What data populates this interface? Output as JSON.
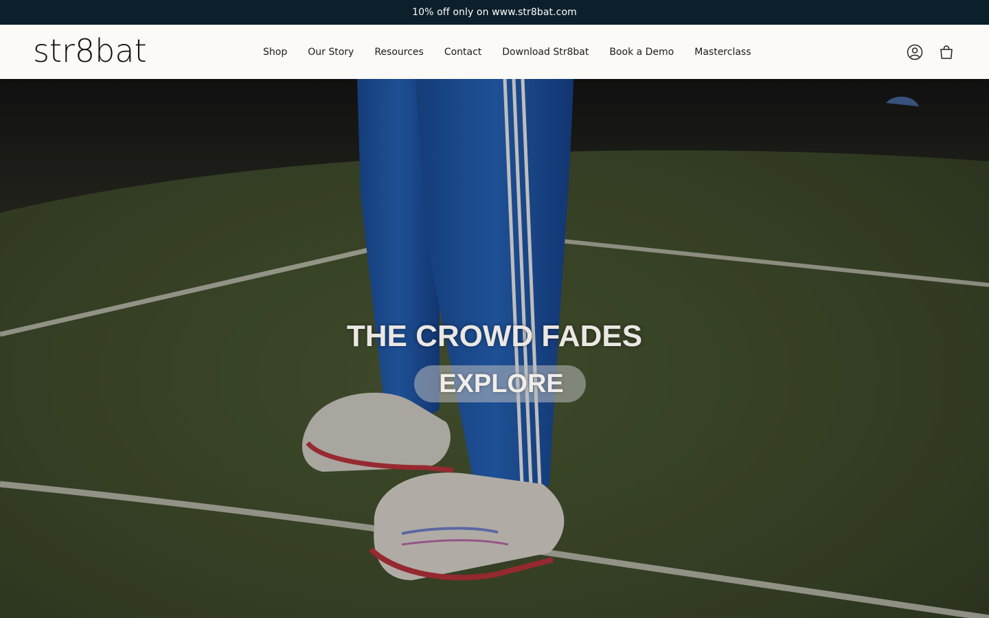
{
  "announcement": {
    "text": "10% off only on www.str8bat.com"
  },
  "header": {
    "logo_text": "str8bat",
    "nav": [
      {
        "label": "Shop"
      },
      {
        "label": "Our Story"
      },
      {
        "label": "Resources"
      },
      {
        "label": "Contact"
      },
      {
        "label": "Download Str8bat"
      },
      {
        "label": "Book a Demo"
      },
      {
        "label": "Masterclass"
      }
    ],
    "icons": {
      "account": "account-icon",
      "cart": "cart-icon"
    }
  },
  "hero": {
    "title": "THE CROWD FADES",
    "cta_label": "EXPLORE"
  },
  "colors": {
    "announcement_bg": "#0c202b",
    "header_bg": "#fbfaf7",
    "turf_green": "#3e4a2a",
    "track_blue": "#1c56a8"
  }
}
